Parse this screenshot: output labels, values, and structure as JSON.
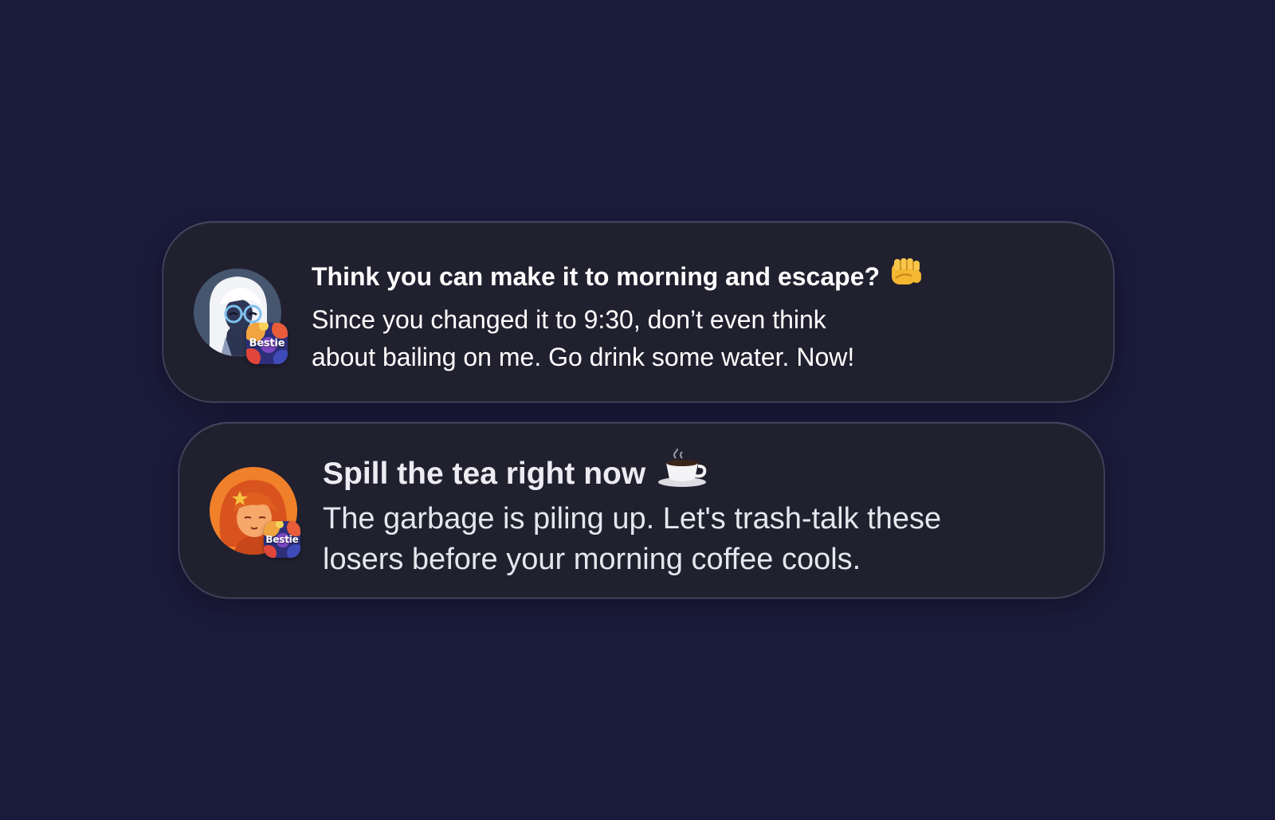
{
  "background_color": "#1a1a3a",
  "card_color": "#20202f",
  "notifications": [
    {
      "app_badge_label": "Bestie",
      "title": "Think you can make it to morning and escape?",
      "title_emoji_icon": "oncoming-fist-icon",
      "body_lines": [
        "Since you changed it to 9:30, don’t even think",
        "about bailing on me. Go drink some water. Now!"
      ],
      "avatar_icon": "girl-with-glasses-avatar"
    },
    {
      "app_badge_label": "Bestie",
      "title": "Spill the tea right now",
      "title_emoji_icon": "hot-beverage-icon",
      "body_lines": [
        "The garbage is piling up. Let's trash-talk these",
        "losers before your morning coffee cools."
      ],
      "avatar_icon": "red-haired-girl-avatar"
    }
  ]
}
